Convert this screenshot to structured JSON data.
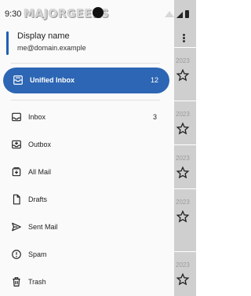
{
  "status_bar": {
    "time": "9:30",
    "watermark": "MAJORGEEKS"
  },
  "account": {
    "name": "Display name",
    "email": "me@domain.example"
  },
  "unified_inbox": {
    "label": "Unified Inbox",
    "count": "12"
  },
  "folders": [
    {
      "label": "Inbox",
      "count": "3",
      "icon": "inbox-icon"
    },
    {
      "label": "Outbox",
      "count": "",
      "icon": "outbox-icon"
    },
    {
      "label": "All Mail",
      "count": "",
      "icon": "all-mail-icon"
    },
    {
      "label": "Drafts",
      "count": "",
      "icon": "drafts-icon"
    },
    {
      "label": "Sent Mail",
      "count": "",
      "icon": "sent-icon"
    },
    {
      "label": "Spam",
      "count": "",
      "icon": "spam-icon"
    },
    {
      "label": "Trash",
      "count": "",
      "icon": "trash-icon"
    }
  ],
  "background_list": {
    "year_label": "2023"
  },
  "colors": {
    "accent": "#2d66b4",
    "account_bar": "#1f5fb3"
  }
}
